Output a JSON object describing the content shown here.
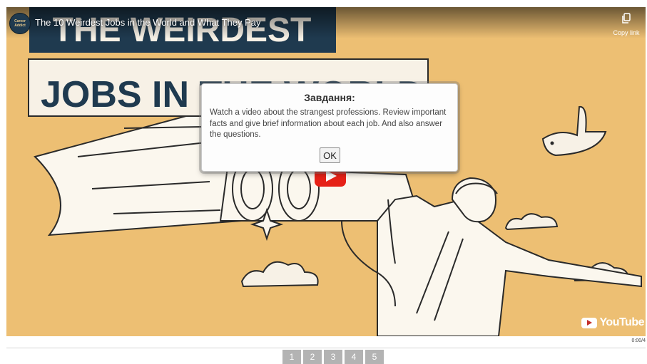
{
  "video": {
    "title": "The 10 Weirdest Jobs in the World and What They Pay",
    "channel_avatar_text": "Career Addict",
    "thumbnail_line1": "THE WEIRDEST",
    "thumbnail_line2": "JOBS IN THE WORLD",
    "copy_link_label": "Copy link",
    "youtube_logo_text": "YouTube",
    "time_display": "0:00/4",
    "background_color": "#edbf73",
    "banner_color": "#1f3a4f"
  },
  "modal": {
    "title": "Завдання:",
    "body": "Watch a video about the strangest professions. Review important facts and give brief information about each job. And also answer the questions.",
    "ok_label": "OK"
  },
  "pagination": {
    "pages": [
      "1",
      "2",
      "3",
      "4",
      "5"
    ]
  }
}
